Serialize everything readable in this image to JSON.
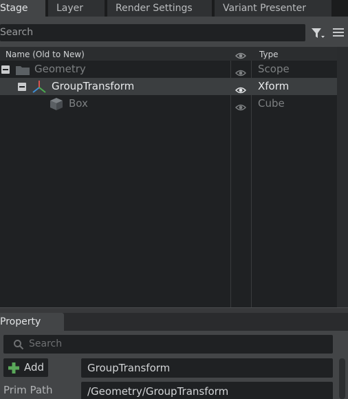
{
  "tabs": [
    {
      "label": "Stage",
      "active": true
    },
    {
      "label": "Layer",
      "active": false
    },
    {
      "label": "Render Settings",
      "active": false
    },
    {
      "label": "Variant Presenter",
      "active": false
    }
  ],
  "toolbar": {
    "search_placeholder": "Search",
    "filter_icon": "filter-icon",
    "menu_icon": "hamburger-menu-icon"
  },
  "tree": {
    "columns": {
      "name": "Name (Old to New)",
      "visibility_icon": "eye-icon",
      "type": "Type"
    },
    "rows": [
      {
        "label": "Geometry",
        "type": "Scope",
        "expanded": true,
        "icon": "folder-icon",
        "selected": false
      },
      {
        "label": "GroupTransform",
        "type": "Xform",
        "expanded": true,
        "icon": "xform-axes-icon",
        "selected": true
      },
      {
        "label": "Box",
        "type": "Cube",
        "expanded": false,
        "icon": "cube-icon",
        "selected": false
      }
    ]
  },
  "property": {
    "tab_label": "Property",
    "search_placeholder": "Search",
    "add_label": "Add",
    "name_value": "GroupTransform",
    "prim_path_label": "Prim Path",
    "prim_path_value": "/Geometry/GroupTransform"
  },
  "colors": {
    "background": "#1f2123",
    "panel": "#434547",
    "selected_row": "#3b3e40",
    "add_plus_green": "#5aa85a",
    "axis_red": "#d9534f",
    "axis_green": "#4caf50",
    "axis_blue": "#3f8fd6"
  }
}
